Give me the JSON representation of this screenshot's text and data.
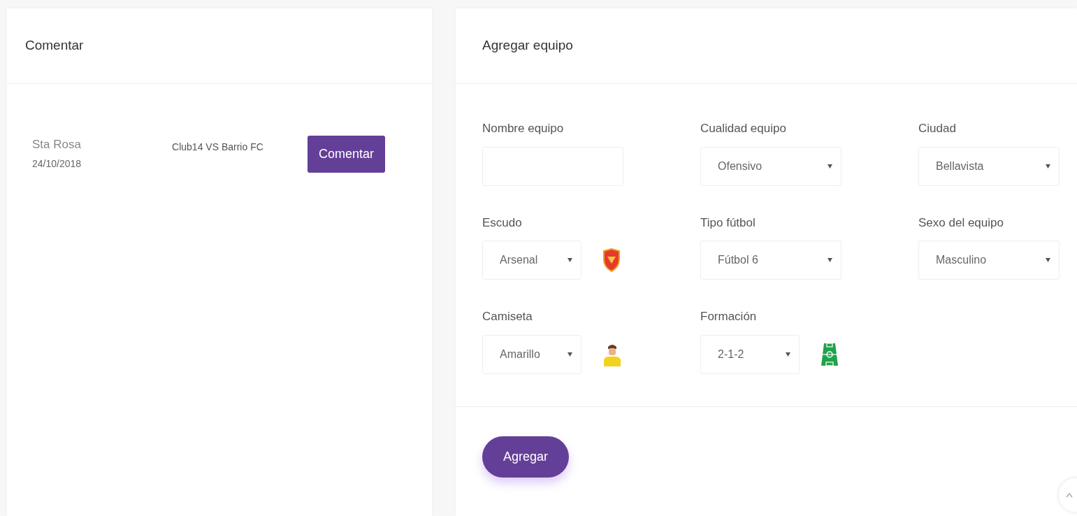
{
  "comment_panel": {
    "title": "Comentar",
    "matches": [
      {
        "place": "Sta Rosa",
        "date": "24/10/2018",
        "teams": "Club14 VS Barrio FC",
        "button": "Comentar"
      }
    ]
  },
  "team_panel": {
    "title": "Agregar equipo",
    "fields": [
      {
        "kind": "text",
        "label": "Nombre equipo"
      },
      {
        "kind": "select",
        "label": "Cualidad equipo",
        "value": "Ofensivo"
      },
      {
        "kind": "select",
        "label": "Ciudad",
        "value": "Bellavista"
      },
      {
        "kind": "select",
        "label": "Escudo",
        "value": "Arsenal"
      },
      {
        "kind": "select",
        "label": "Tipo fútbol",
        "value": "Fútbol 6"
      },
      {
        "kind": "select",
        "label": "Sexo del equipo",
        "value": "Masculino"
      },
      {
        "kind": "select",
        "label": "Camiseta",
        "value": "Amarillo"
      },
      {
        "kind": "select",
        "label": "Formación",
        "value": "2-1-2"
      }
    ],
    "submit": "Agregar"
  }
}
